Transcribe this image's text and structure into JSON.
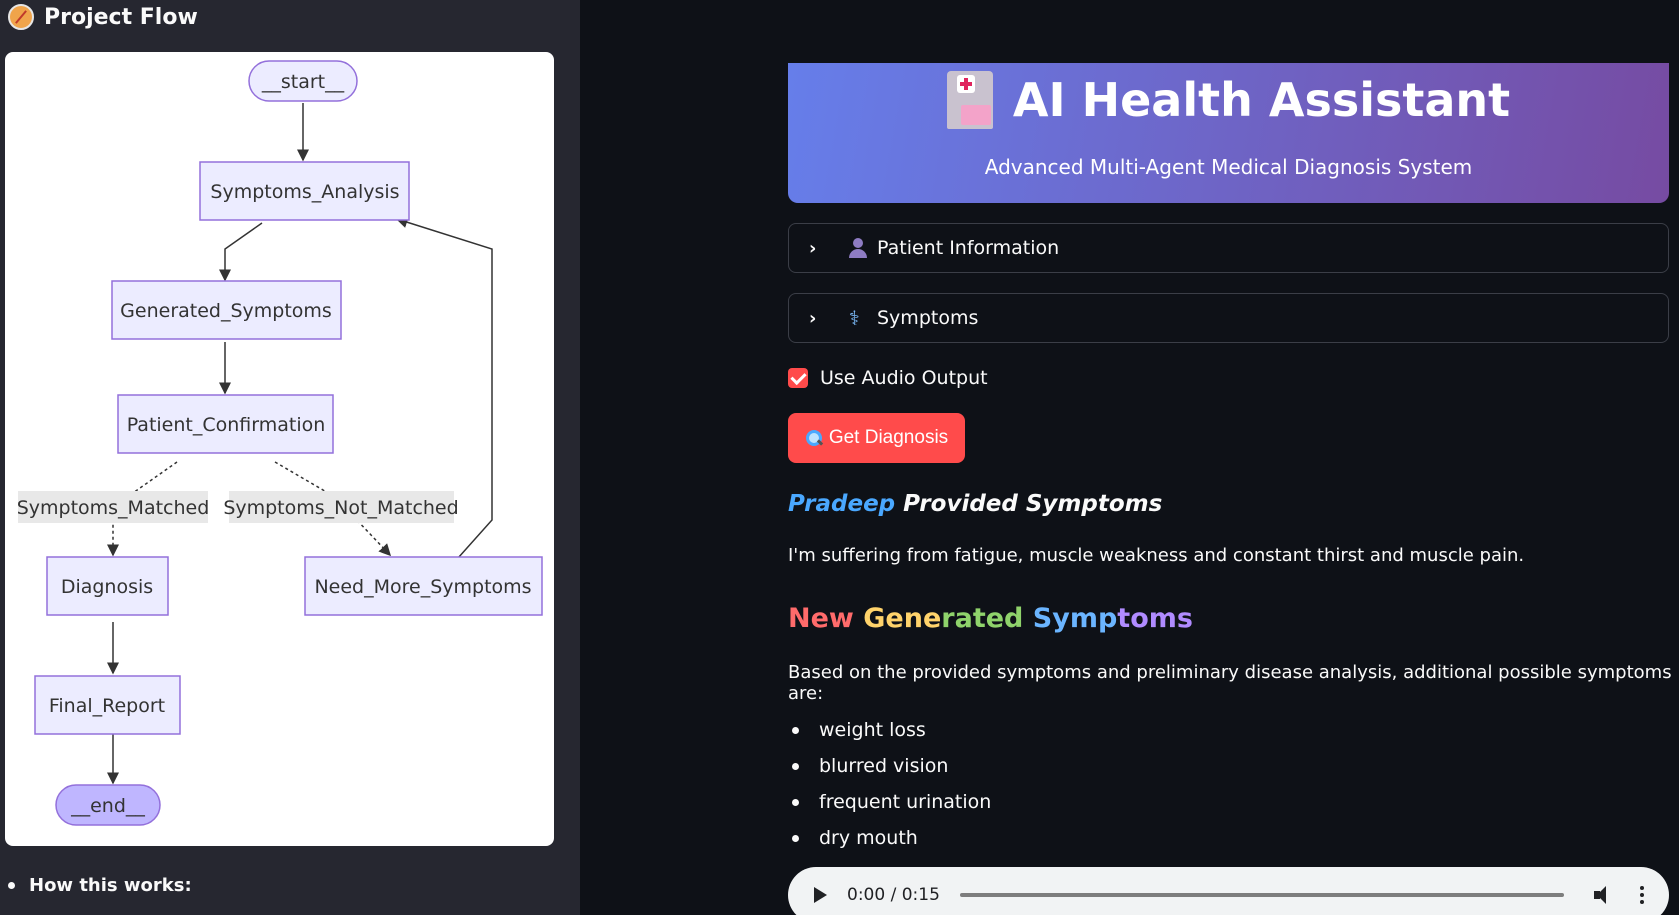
{
  "sidebar": {
    "title": "Project Flow",
    "how_label": "How this works:",
    "flow": {
      "nodes": {
        "start": "__start__",
        "symptoms_analysis": "Symptoms_Analysis",
        "generated_symptoms": "Generated_Symptoms",
        "patient_confirmation": "Patient_Confirmation",
        "diagnosis": "Diagnosis",
        "need_more_symptoms": "Need_More_Symptoms",
        "final_report": "Final_Report",
        "end": "__end__"
      },
      "edge_labels": {
        "matched": "Symptoms_Matched",
        "not_matched": "Symptoms_Not_Matched"
      }
    }
  },
  "header": {
    "title": "AI Health Assistant",
    "subtitle": "Advanced Multi-Agent Medical Diagnosis System",
    "gradient": [
      "#667eea",
      "#764ba2"
    ]
  },
  "expanders": {
    "patient_info": "Patient Information",
    "symptoms": "Symptoms"
  },
  "audio_output": {
    "label": "Use Audio Output",
    "checked": true
  },
  "diagnose_button": {
    "label": "Get Diagnosis",
    "color": "#ff4b4b"
  },
  "provided": {
    "name": "Pradeep",
    "heading_rest": "Provided Symptoms",
    "text": "I'm suffering from fatigue, muscle weakness and constant thirst and muscle pain."
  },
  "generated": {
    "heading_words": [
      "New",
      "Gene",
      "rated",
      "Symp",
      "toms"
    ],
    "intro": "Based on the provided symptoms and preliminary disease analysis, additional possible symptoms are:",
    "items": [
      "weight loss",
      "blurred vision",
      "frequent urination",
      "dry mouth"
    ]
  },
  "audio_player": {
    "time": "0:00 / 0:15"
  }
}
